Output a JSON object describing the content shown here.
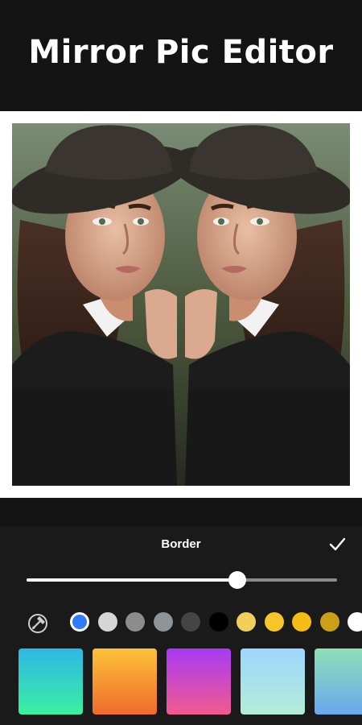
{
  "banner": {
    "title": "Mirror Pic Editor"
  },
  "photo": {
    "description_icon": "mirrored-portrait-image"
  },
  "panel": {
    "title": "Border",
    "confirm_icon": "checkmark-icon",
    "slider": {
      "value_fraction": 0.68
    },
    "picker_icon": "color-picker-icon",
    "colors": [
      {
        "hex": "#2f7cf6",
        "selected": true
      },
      {
        "hex": "#d6d6d6",
        "selected": false
      },
      {
        "hex": "#8c8c8c",
        "selected": false
      },
      {
        "hex": "#8e9497",
        "selected": false
      },
      {
        "hex": "#454545",
        "selected": false
      },
      {
        "hex": "#000000",
        "selected": false
      },
      {
        "hex": "#f2cf5a",
        "selected": false
      },
      {
        "hex": "#f5c52a",
        "selected": false
      },
      {
        "hex": "#f4bc14",
        "selected": false
      },
      {
        "hex": "#c9a016",
        "selected": false
      },
      {
        "hex": "#ffffff",
        "selected": false
      }
    ],
    "gradients": [
      {
        "from": "#2eb7e6",
        "to": "#3bf0a0"
      },
      {
        "from": "#fcc238",
        "to": "#f06a2c"
      },
      {
        "from": "#a83af6",
        "to": "#f25a8c"
      },
      {
        "from": "#9ed6ff",
        "to": "#b4ecd8"
      },
      {
        "from": "#8ee0b6",
        "to": "#69a8ee"
      }
    ]
  }
}
